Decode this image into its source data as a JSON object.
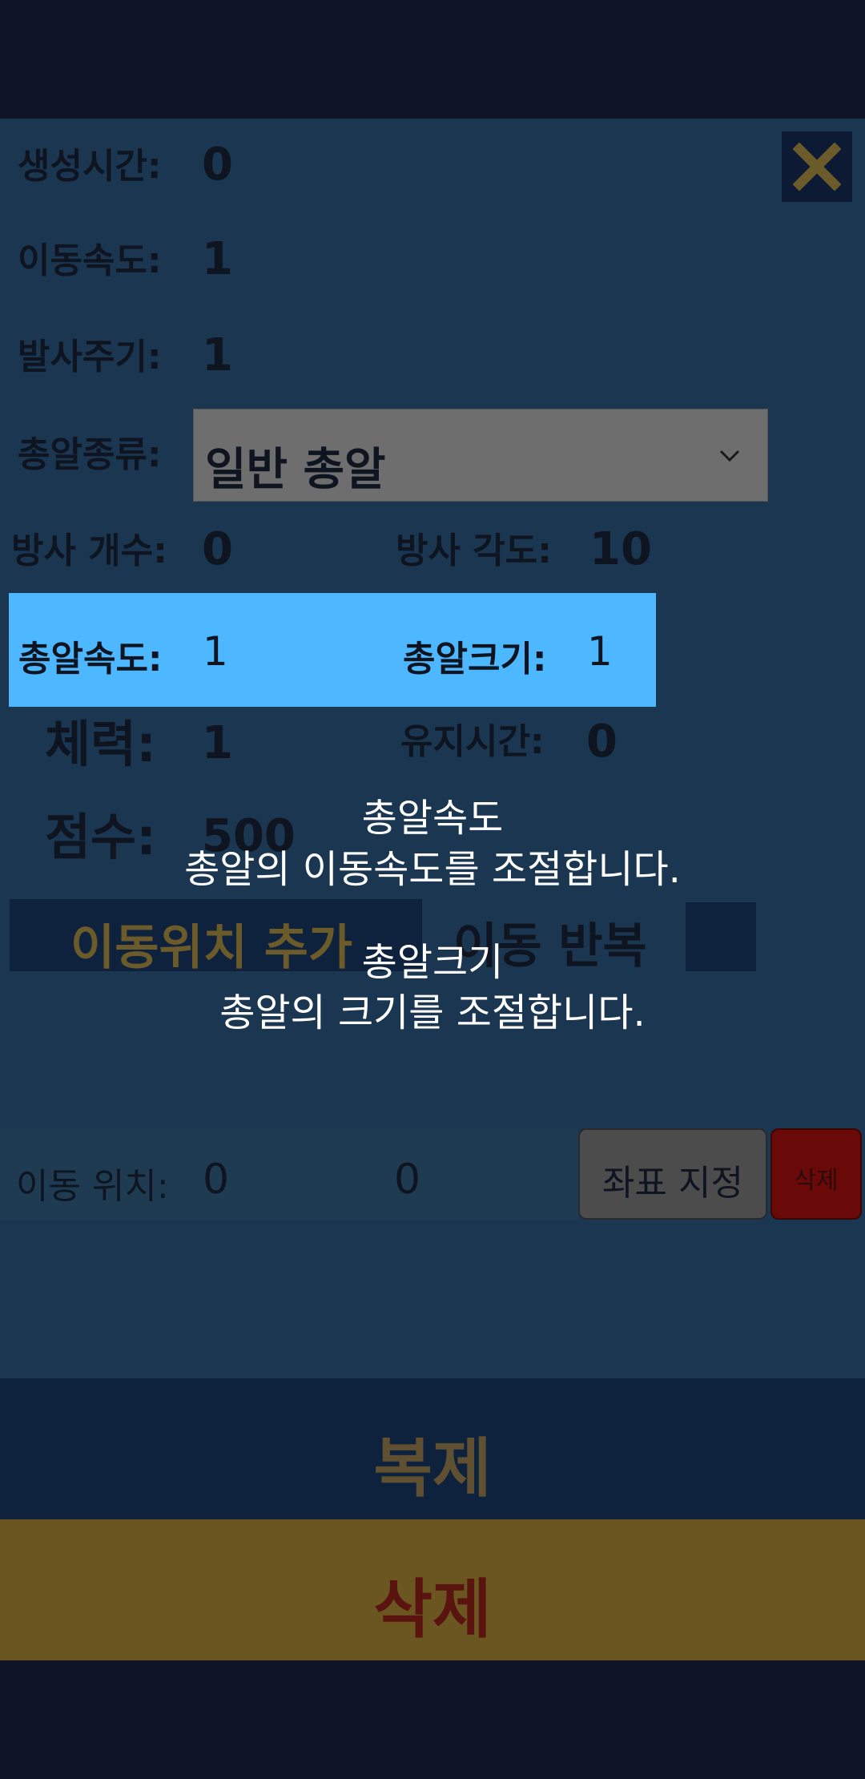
{
  "stats": {
    "spawn_time_label": "생성시간:",
    "spawn_time_value": "0",
    "move_speed_label": "이동속도:",
    "move_speed_value": "1",
    "fire_period_label": "발사주기:",
    "fire_period_value": "1",
    "bullet_type_label": "총알종류:",
    "bullet_type_value": "일반 총알",
    "fire_count_label": "방사 개수:",
    "fire_count_value": "0",
    "fire_angle_label": "방사 각도:",
    "fire_angle_value": "10",
    "bullet_speed_label": "총알속도:",
    "bullet_speed_value": "1",
    "bullet_size_label": "총알크기:",
    "bullet_size_value": "1",
    "hp_label": "체력:",
    "hp_value": "1",
    "duration_label": "유지시간:",
    "duration_value": "0",
    "score_label": "점수:",
    "score_value": "500"
  },
  "movement": {
    "add_label": "이동위치 추가",
    "repeat_label": "이동 반복",
    "position_label": "이동 위치:",
    "x_value": "0",
    "y_value": "0",
    "set_coord_label": "좌표 지정",
    "delete_small_label": "삭제"
  },
  "tooltip": {
    "title1": "총알속도",
    "desc1": "총알의 이동속도를 조절합니다.",
    "title2": "총알크기",
    "desc2": "총알의 크기를 조절합니다."
  },
  "actions": {
    "duplicate_label": "복제",
    "delete_label": "삭제"
  },
  "icons": {
    "close": "close-icon",
    "dropdown": "chevron-down-icon"
  },
  "colors": {
    "highlight": "#4db8ff",
    "panel": "#1a3650",
    "accent_gold": "#6b5520",
    "danger": "#6a0a08"
  }
}
